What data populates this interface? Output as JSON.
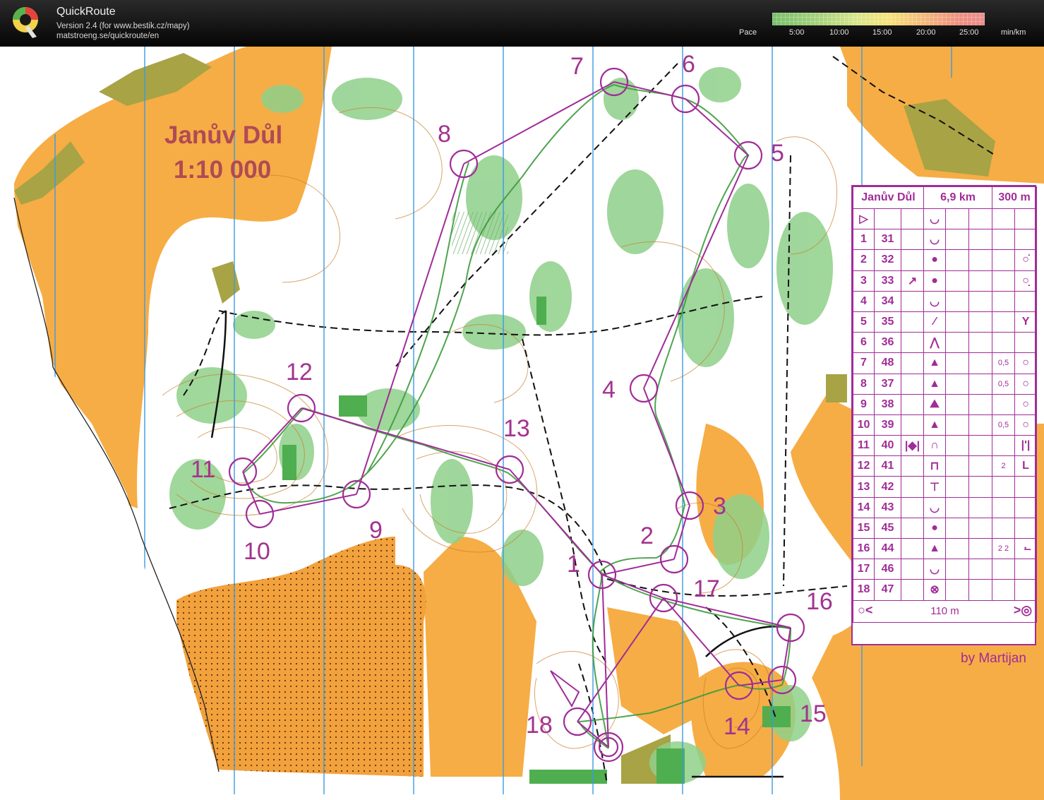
{
  "app": {
    "name": "QuickRoute",
    "version": "Version 2.4  (for www.bestik.cz/mapy)",
    "url": "matstroeng.se/quickroute/en"
  },
  "pace_legend": {
    "label": "Pace",
    "ticks": [
      "5:00",
      "10:00",
      "15:00",
      "20:00",
      "25:00"
    ],
    "unit": "min/km"
  },
  "map": {
    "title": "Janův Důl",
    "scale": "1:10 000",
    "credit": "by Martijan",
    "controls": [
      {
        "label": "1"
      },
      {
        "label": "2"
      },
      {
        "label": "3"
      },
      {
        "label": "4"
      },
      {
        "label": "5"
      },
      {
        "label": "6"
      },
      {
        "label": "7"
      },
      {
        "label": "8"
      },
      {
        "label": "9"
      },
      {
        "label": "10"
      },
      {
        "label": "11"
      },
      {
        "label": "12"
      },
      {
        "label": "13"
      },
      {
        "label": "14"
      },
      {
        "label": "15"
      },
      {
        "label": "16"
      },
      {
        "label": "17"
      },
      {
        "label": "18"
      }
    ],
    "colors": {
      "course": "#a02c98",
      "open": "#f7ad42",
      "forest_green": "#7cc47c",
      "contour": "#c67a2a",
      "water_line": "#3c9be0"
    }
  },
  "description_sheet": {
    "header": {
      "event": "Janův Důl",
      "length": "6,9 km",
      "climb": "300 m"
    },
    "start_symbol": "start-triangle",
    "rows": [
      {
        "num": "1",
        "code": "31",
        "d": "",
        "feat": "◡",
        "dim": "",
        "ext": ""
      },
      {
        "num": "2",
        "code": "32",
        "d": "",
        "feat": "●",
        "dim": "",
        "ext": "○̇"
      },
      {
        "num": "3",
        "code": "33",
        "d": "↗",
        "feat": "●",
        "dim": "",
        "ext": "○̣"
      },
      {
        "num": "4",
        "code": "34",
        "d": "",
        "feat": "◡",
        "dim": "",
        "ext": ""
      },
      {
        "num": "5",
        "code": "35",
        "d": "",
        "feat": "⁄",
        "dim": "",
        "ext": "Y"
      },
      {
        "num": "6",
        "code": "36",
        "d": "",
        "feat": "⋀",
        "dim": "",
        "ext": ""
      },
      {
        "num": "7",
        "code": "48",
        "d": "",
        "feat": "▲",
        "dim": "0,5",
        "ext": "○"
      },
      {
        "num": "8",
        "code": "37",
        "d": "",
        "feat": "▲",
        "dim": "0,5",
        "ext": "○"
      },
      {
        "num": "9",
        "code": "38",
        "d": "",
        "feat": "⛰",
        "dim": "",
        "ext": "○"
      },
      {
        "num": "10",
        "code": "39",
        "d": "",
        "feat": "▲",
        "dim": "0,5",
        "ext": "○"
      },
      {
        "num": "11",
        "code": "40",
        "d": "|◆|",
        "feat": "∩",
        "dim": "",
        "ext": "|'|"
      },
      {
        "num": "12",
        "code": "41",
        "d": "",
        "feat": "⊓",
        "dim": "2",
        "ext": "L"
      },
      {
        "num": "13",
        "code": "42",
        "d": "",
        "feat": "⊤",
        "dim": "",
        "ext": ""
      },
      {
        "num": "14",
        "code": "43",
        "d": "",
        "feat": "◡",
        "dim": "",
        "ext": ""
      },
      {
        "num": "15",
        "code": "45",
        "d": "",
        "feat": "●",
        "dim": "",
        "ext": ""
      },
      {
        "num": "16",
        "code": "44",
        "d": "",
        "feat": "▲",
        "dim": "2 2",
        "ext": "·̶"
      },
      {
        "num": "17",
        "code": "46",
        "d": "",
        "feat": "◡",
        "dim": "",
        "ext": ""
      },
      {
        "num": "18",
        "code": "47",
        "d": "",
        "feat": "⊗",
        "dim": "",
        "ext": ""
      }
    ],
    "finish": "110 m"
  }
}
